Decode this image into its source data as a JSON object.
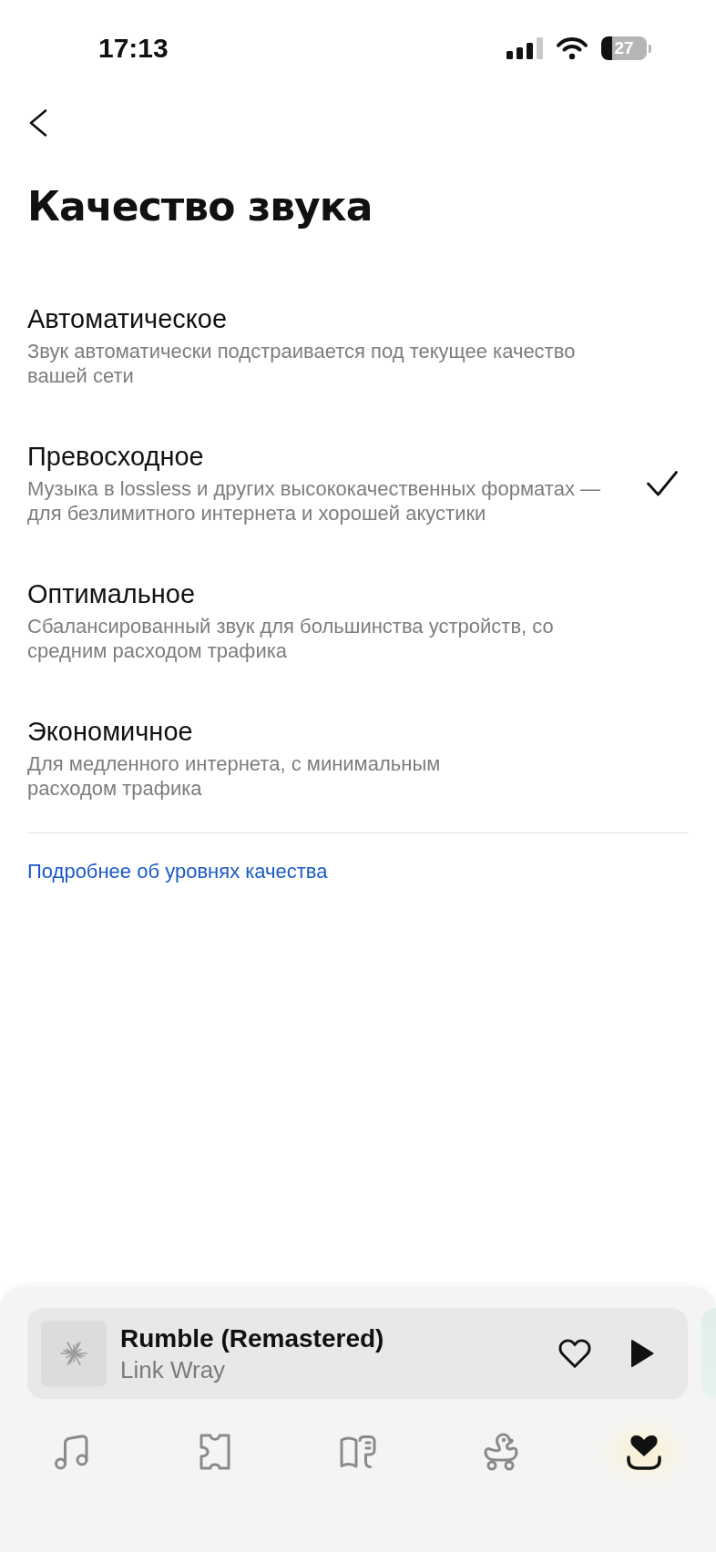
{
  "status_bar": {
    "time": "17:13",
    "battery": "27"
  },
  "header": {
    "title": "Качество звука"
  },
  "options": [
    {
      "title": "Автоматическое",
      "description": "Звук автоматически подстраивается под текущее качество\nвашей сети",
      "selected": false
    },
    {
      "title": "Превосходное",
      "description": "Музыка в lossless и других высококачественных форматах —\nдля безлимитного интернета и хорошей акустики",
      "selected": true
    },
    {
      "title": "Оптимальное",
      "description": "Сбалансированный звук для большинства устройств, со\nсредним расходом трафика",
      "selected": false
    },
    {
      "title": "Экономичное",
      "description": "Для медленного интернета, с минимальным\nрасходом трафика",
      "selected": false
    }
  ],
  "link": "Подробнее об уровнях качества",
  "mini_player": {
    "title": "Rumble (Remastered)",
    "artist": "Link Wray",
    "liked": false
  },
  "tabs": [
    {
      "kind": "music",
      "selected": false
    },
    {
      "kind": "ticket",
      "selected": false
    },
    {
      "kind": "book",
      "selected": false
    },
    {
      "kind": "duck",
      "selected": false
    },
    {
      "kind": "collection",
      "selected": true
    }
  ]
}
